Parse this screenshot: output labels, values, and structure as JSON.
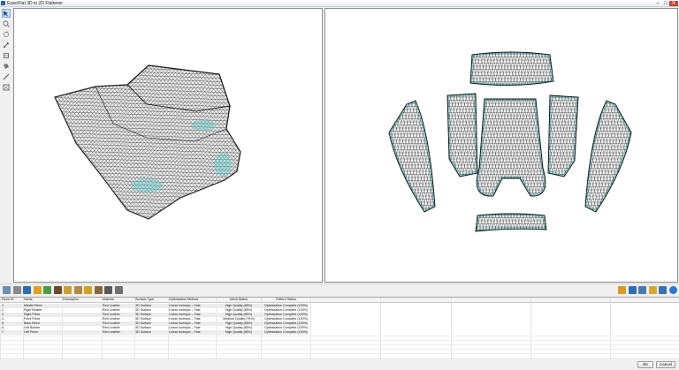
{
  "window": {
    "title": "ExactFlat 3D to 2D Flattener",
    "minimize": "–",
    "maximize": "□",
    "close": "✕"
  },
  "left_tools": [
    {
      "name": "select-tool-icon",
      "active": true
    },
    {
      "name": "zoom-tool-icon",
      "active": false
    },
    {
      "name": "rotate-tool-icon",
      "active": false
    },
    {
      "name": "pin-tool-icon",
      "active": false
    },
    {
      "name": "seam-tool-icon",
      "active": false
    },
    {
      "name": "piece-tool-icon",
      "active": false
    },
    {
      "name": "measure-tool-icon",
      "active": false
    },
    {
      "name": "fit-tool-icon",
      "active": false
    }
  ],
  "middle_toolbar_left": [
    {
      "name": "flatten-icon",
      "color": "#6a8fb5"
    },
    {
      "name": "piece-add-icon",
      "color": "#8a8a8a"
    },
    {
      "name": "material-icon",
      "color": "#2d6fb7"
    },
    {
      "name": "quality-icon",
      "color": "#e0a020"
    },
    {
      "name": "pattern-icon",
      "color": "#4a9a4a"
    },
    {
      "name": "seam-allowance-icon",
      "color": "#6b4c2a"
    },
    {
      "name": "ruler-icon",
      "color": "#c9a030"
    },
    {
      "name": "notch-icon",
      "color": "#b08a40"
    },
    {
      "name": "label-icon",
      "color": "#d4a020"
    },
    {
      "name": "grain-icon",
      "color": "#8a6a3a"
    },
    {
      "name": "export-icon",
      "color": "#5a5a5a"
    },
    {
      "name": "settings-icon",
      "color": "#707070"
    }
  ],
  "middle_toolbar_right": [
    {
      "name": "report-icon",
      "color": "#d89a20"
    },
    {
      "name": "globe-icon",
      "color": "#2f6fb8"
    },
    {
      "name": "print-icon",
      "color": "#4a7ab0"
    },
    {
      "name": "folder-icon",
      "color": "#d4a830"
    },
    {
      "name": "save-icon",
      "color": "#3a70b8"
    },
    {
      "name": "help-icon",
      "color": "#2a78d0"
    }
  ],
  "table": {
    "columns": [
      "Piece ID",
      "Name",
      "Description",
      "Material",
      "Surface Type",
      "Optimization Method",
      "Mesh Status",
      "Pattern Status"
    ],
    "rows": [
      [
        "1",
        "Middle Piece",
        "",
        "Red Leather",
        "3D Surface",
        "Linear Isotropic – Fast",
        "High Quality (85%)",
        "Optimization Complete (100%)"
      ],
      [
        "2",
        "Right Bolster",
        "",
        "Red Leather",
        "3D Surface",
        "Linear Isotropic – Fast",
        "High Quality (85%)",
        "Optimization Complete (100%)"
      ],
      [
        "3",
        "Right Piece",
        "",
        "Red Leather",
        "3D Surface",
        "Linear Isotropic – Fast",
        "High Quality (85%)",
        "Optimization Complete (100%)"
      ],
      [
        "4",
        "Front Piece",
        "",
        "Red Leather",
        "3D Surface",
        "Linear Isotropic – Fast",
        "Medium Quality (76%)",
        "Optimization Complete (100%)"
      ],
      [
        "5",
        "Back Piece",
        "",
        "Red Leather",
        "3D Surface",
        "Linear Isotropic – Fast",
        "High Quality (85%)",
        "Optimization Complete (100%)"
      ],
      [
        "6",
        "Left Bolster",
        "",
        "Red Leather",
        "3D Surface",
        "Linear Isotropic – Fast",
        "High Quality (85%)",
        "Optimization Complete (100%)"
      ],
      [
        "7",
        "Left Piece",
        "",
        "Red Leather",
        "3D Surface",
        "Linear Isotropic – Fast",
        "High Quality (85%)",
        "Optimization Complete (100%)"
      ]
    ]
  },
  "buttons": {
    "ok": "OK",
    "cancel": "Cancel"
  },
  "colors": {
    "mesh_line": "#1a1a1a",
    "mesh_tint": "#5fc7c9",
    "active_tool": "#cfe2f7"
  }
}
